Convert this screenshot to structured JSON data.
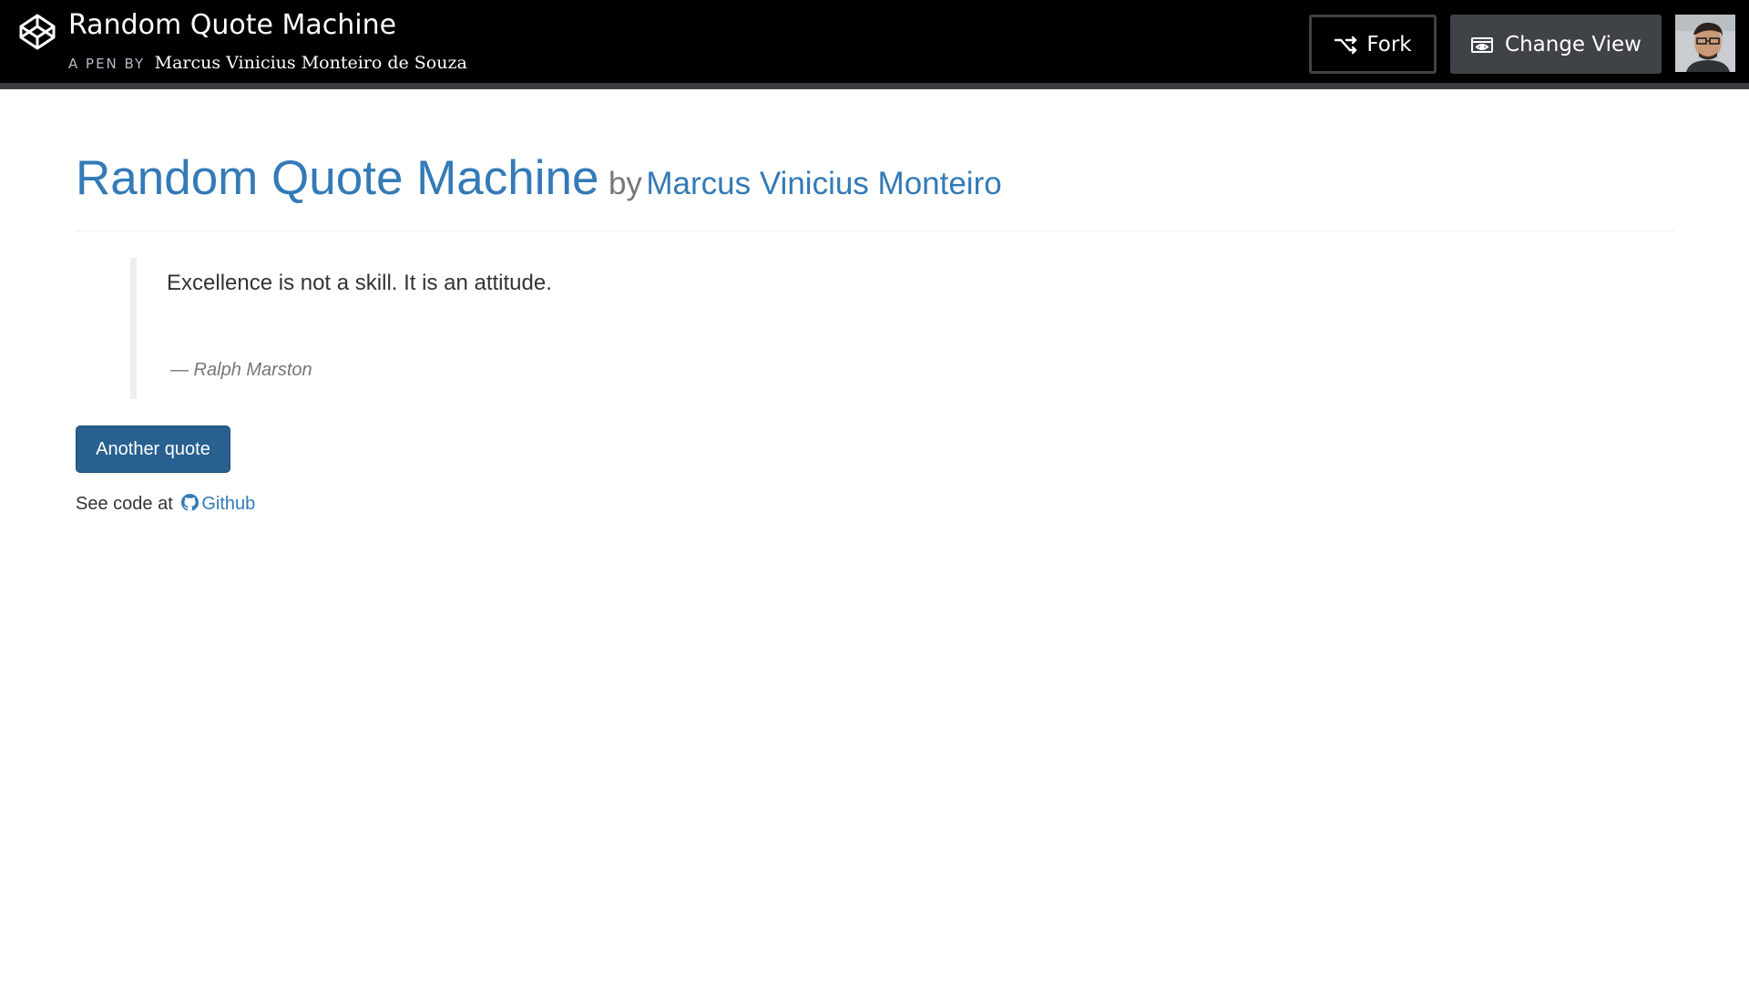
{
  "header": {
    "pen_title": "Random Quote Machine",
    "byline_prefix": "A PEN BY",
    "author": "Marcus Vinicius Monteiro de Souza",
    "fork_label": "Fork",
    "change_view_label": "Change View"
  },
  "main": {
    "title": "Random Quote Machine",
    "by": "by",
    "author_link": "Marcus Vinicius Monteiro",
    "quote_text": "Excellence is not a skill. It is an attitude.",
    "quote_author": "— Ralph Marston",
    "button_label": "Another quote",
    "see_code_prefix": "See code at",
    "github_label": "Github"
  },
  "icons": {
    "logo": "codepen-logo-icon",
    "fork": "fork-icon",
    "view": "eye-icon",
    "github": "github-icon"
  },
  "colors": {
    "link": "#337ab7",
    "button": "#286090",
    "topbar": "#000000",
    "topbar_button": "#3f4247"
  }
}
